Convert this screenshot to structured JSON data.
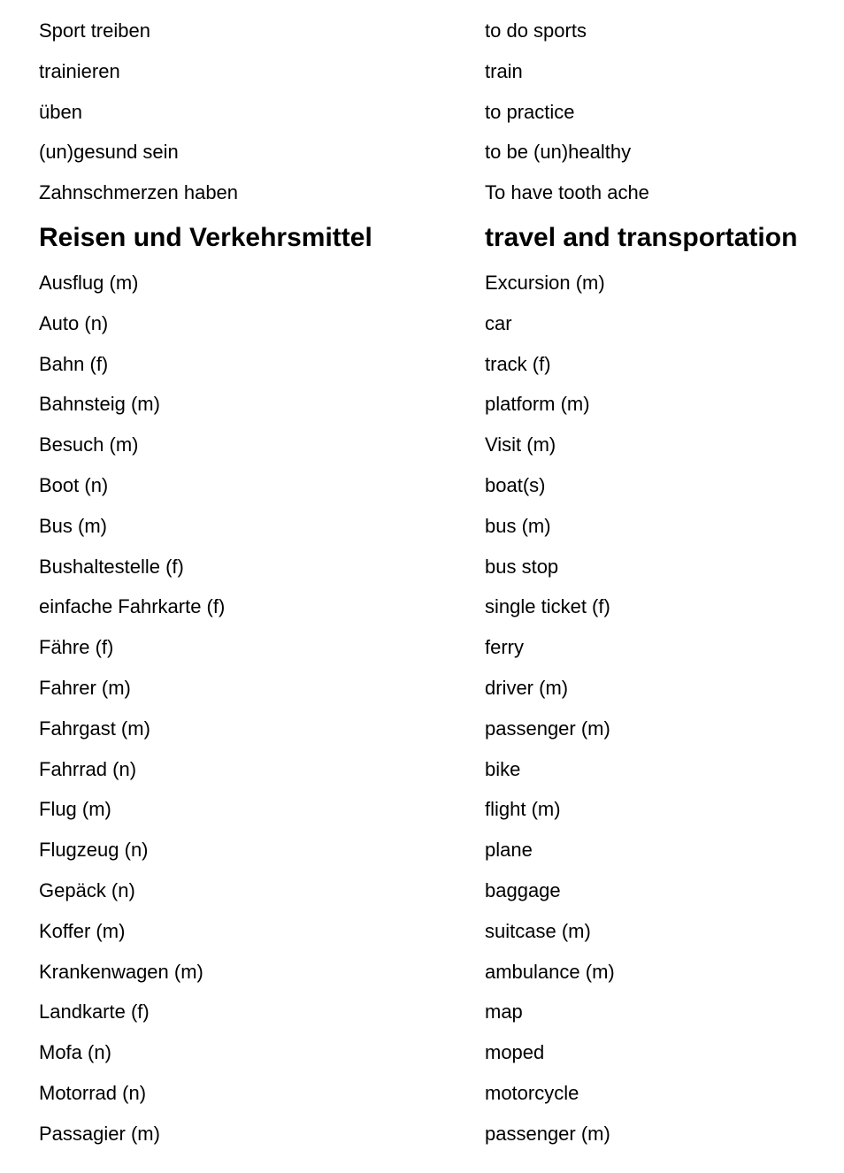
{
  "rows": [
    {
      "de": "Sport treiben",
      "en": "to do sports"
    },
    {
      "de": "trainieren",
      "en": "train"
    },
    {
      "de": "üben",
      "en": "to practice"
    },
    {
      "de": "(un)gesund sein",
      "en": "to be (un)healthy"
    },
    {
      "de": "Zahnschmerzen haben",
      "en": "To have tooth ache"
    },
    {
      "de": "Reisen und Verkehrsmittel",
      "en": "travel and transportation",
      "heading": true
    },
    {
      "de": "Ausflug (m)",
      "en": "Excursion (m)"
    },
    {
      "de": "Auto (n)",
      "en": "car"
    },
    {
      "de": "Bahn (f)",
      "en": "track (f)"
    },
    {
      "de": "Bahnsteig (m)",
      "en": "platform (m)"
    },
    {
      "de": "Besuch (m)",
      "en": "Visit (m)"
    },
    {
      "de": "Boot (n)",
      "en": "boat(s)"
    },
    {
      "de": "Bus (m)",
      "en": "bus (m)"
    },
    {
      "de": "Bushaltestelle (f)",
      "en": "bus stop"
    },
    {
      "de": "einfache Fahrkarte (f)",
      "en": "single ticket (f)"
    },
    {
      "de": "Fähre (f)",
      "en": "ferry"
    },
    {
      "de": "Fahrer (m)",
      "en": "driver (m)"
    },
    {
      "de": "Fahrgast (m)",
      "en": "passenger (m)"
    },
    {
      "de": "Fahrrad (n)",
      "en": "bike"
    },
    {
      "de": "Flug (m)",
      "en": "flight (m)"
    },
    {
      "de": "Flugzeug (n)",
      "en": "plane"
    },
    {
      "de": "Gepäck (n)",
      "en": "baggage"
    },
    {
      "de": "Koffer (m)",
      "en": "suitcase (m)"
    },
    {
      "de": "Krankenwagen (m)",
      "en": "ambulance (m)"
    },
    {
      "de": "Landkarte (f)",
      "en": "map"
    },
    {
      "de": "Mofa (n)",
      "en": "moped"
    },
    {
      "de": "Motorrad (n)",
      "en": "motorcycle"
    },
    {
      "de": "Passagier (m)",
      "en": "passenger (m)"
    }
  ]
}
